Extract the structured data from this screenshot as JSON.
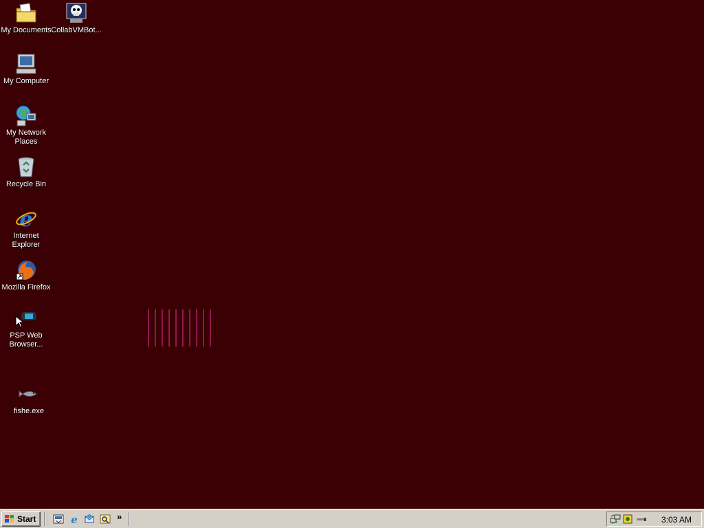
{
  "desktop": {
    "background_color": "#3a0004",
    "icons": [
      {
        "label": "My Documents",
        "icon": "folder-documents-icon"
      },
      {
        "label": "CollabVMBot...",
        "icon": "skull-computer-icon"
      },
      {
        "label": "My Computer",
        "icon": "computer-icon"
      },
      {
        "label": "My Network Places",
        "icon": "network-places-icon"
      },
      {
        "label": "Recycle Bin",
        "icon": "recycle-bin-icon"
      },
      {
        "label": "Internet Explorer",
        "icon": "internet-explorer-icon"
      },
      {
        "label": "Mozilla Firefox",
        "icon": "firefox-icon"
      },
      {
        "label": "PSP Web Browser...",
        "icon": "psp-device-icon"
      },
      {
        "label": "fishe.exe",
        "icon": "fish-icon"
      }
    ]
  },
  "taskbar": {
    "start_label": "Start",
    "quick_launch": [
      "show-desktop-icon",
      "internet-explorer-icon",
      "outlook-express-icon",
      "windows-media-icon"
    ],
    "chevron": "»",
    "tray_icons": [
      "network-icon",
      "security-icon",
      "usb-icon"
    ],
    "clock": "3:03 AM"
  }
}
